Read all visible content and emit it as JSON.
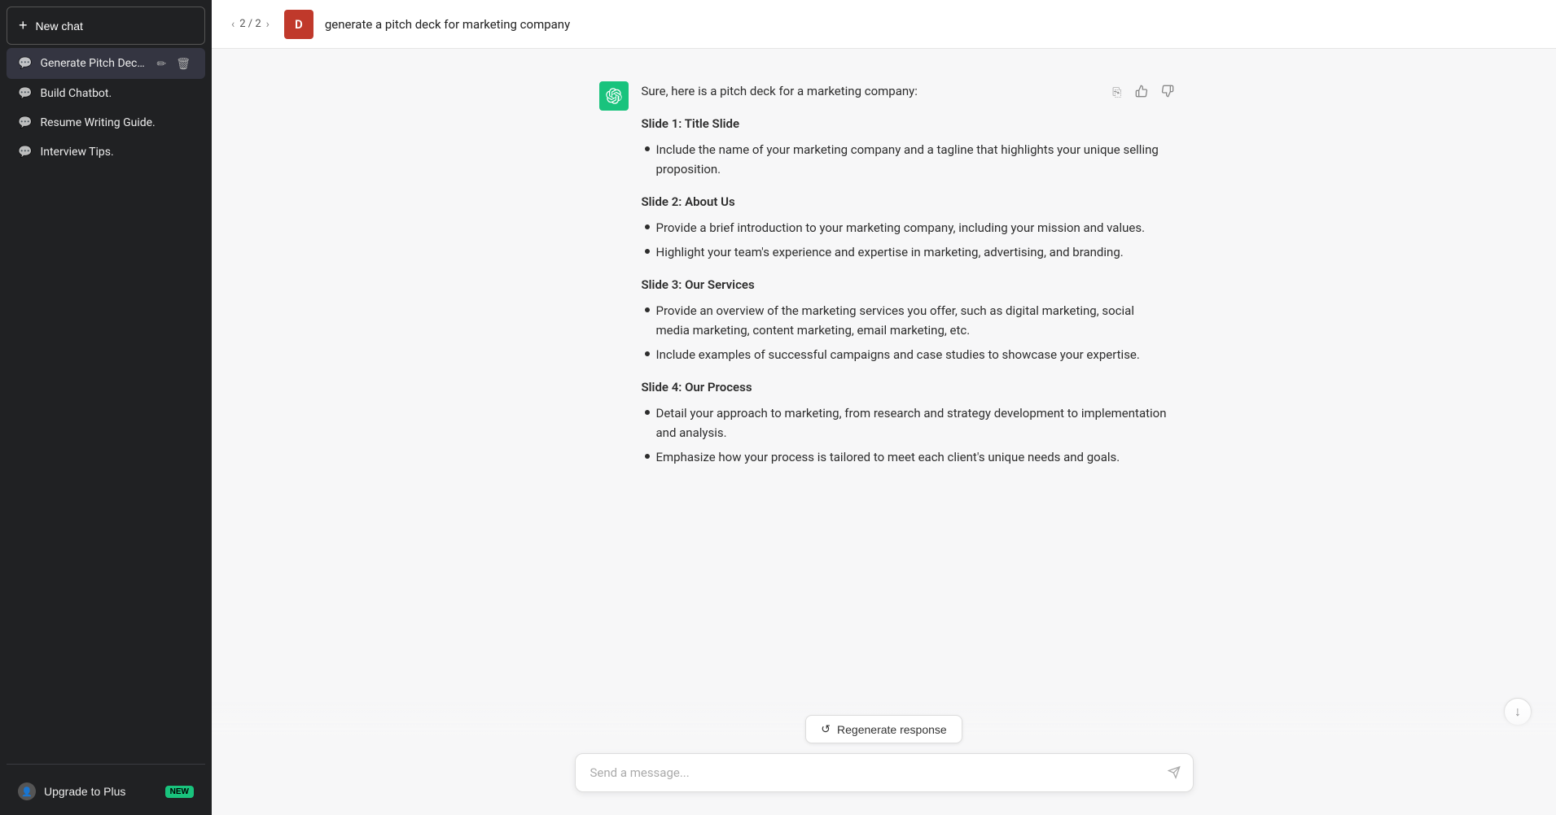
{
  "sidebar": {
    "new_chat_label": "New chat",
    "new_chat_icon": "+",
    "items": [
      {
        "id": "generate-pitch-deck",
        "label": "Generate Pitch Deck.",
        "active": true
      },
      {
        "id": "build-chatbot",
        "label": "Build Chatbot.",
        "active": false
      },
      {
        "id": "resume-writing-guide",
        "label": "Resume Writing Guide.",
        "active": false
      },
      {
        "id": "interview-tips",
        "label": "Interview Tips.",
        "active": false
      }
    ],
    "footer": {
      "upgrade_label": "Upgrade to Plus",
      "new_badge": "NEW"
    }
  },
  "header": {
    "nav": {
      "prev": "‹",
      "counter": "2 / 2",
      "next": "›"
    },
    "user_initial": "D",
    "title": "generate a pitch deck for marketing company"
  },
  "message": {
    "intro": "Sure, here is a pitch deck for a marketing company:",
    "slides": [
      {
        "heading": "Slide 1: Title Slide",
        "bullets": [
          "Include the name of your marketing company and a tagline that highlights your unique selling proposition."
        ]
      },
      {
        "heading": "Slide 2: About Us",
        "bullets": [
          "Provide a brief introduction to your marketing company, including your mission and values.",
          "Highlight your team's experience and expertise in marketing, advertising, and branding."
        ]
      },
      {
        "heading": "Slide 3: Our Services",
        "bullets": [
          "Provide an overview of the marketing services you offer, such as digital marketing, social media marketing, content marketing, email marketing, etc.",
          "Include examples of successful campaigns and case studies to showcase your expertise."
        ]
      },
      {
        "heading": "Slide 4: Our Process",
        "bullets": [
          "Detail your approach to marketing, from research and strategy development to implementation and analysis.",
          "Emphasize how your process is tailored to meet each client's unique needs and goals."
        ]
      }
    ]
  },
  "actions": {
    "copy_icon": "⎘",
    "thumbsup_icon": "👍",
    "thumbsdown_icon": "👎"
  },
  "regenerate": {
    "label": "Regenerate response",
    "icon": "↺"
  },
  "input": {
    "placeholder": "Send a message...",
    "send_icon": "➤"
  },
  "scroll_down": {
    "icon": "↓"
  },
  "edit_icon": "✏",
  "delete_icon": "🗑"
}
